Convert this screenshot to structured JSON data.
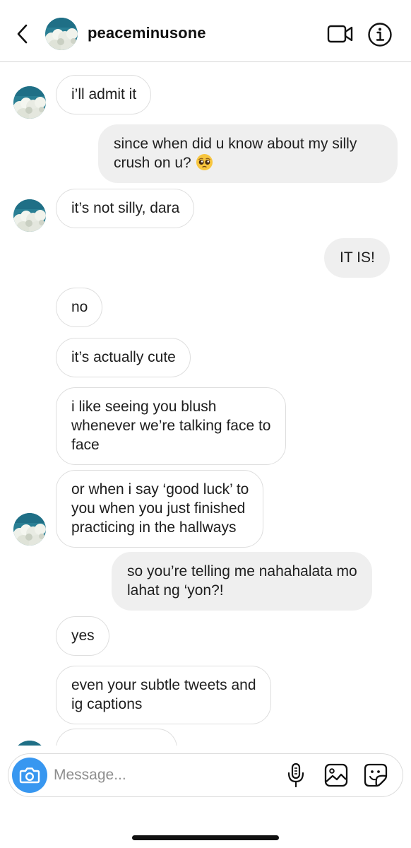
{
  "header": {
    "username": "peaceminusone",
    "back_icon": "chevron-left-icon",
    "video_icon": "video-call-icon",
    "info_icon": "info-icon"
  },
  "messages": [
    {
      "sender": "them",
      "text": "i’ll admit it"
    },
    {
      "sender": "me",
      "line1": "since when did u know about my silly",
      "line2": "crush on u? ",
      "emoji": "pleading-face-emoji"
    },
    {
      "sender": "them",
      "text": "it’s not silly, dara"
    },
    {
      "sender": "me",
      "text": "IT IS!"
    },
    {
      "sender": "them",
      "text": "no"
    },
    {
      "sender": "them",
      "text": "it’s actually cute"
    },
    {
      "sender": "them",
      "line1": "i like seeing you blush",
      "line2": "whenever we’re talking face to",
      "line3": "face"
    },
    {
      "sender": "them",
      "line1": "or when i say ‘good luck’ to",
      "line2": "you when you just finished",
      "line3": "practicing in the hallways"
    },
    {
      "sender": "me",
      "line1": "so you’re telling me nahahalata mo",
      "line2": "lahat ng ‘yon?!"
    },
    {
      "sender": "them",
      "text": "yes"
    },
    {
      "sender": "them",
      "line1": "even your subtle tweets and",
      "line2": "ig captions"
    }
  ],
  "composer": {
    "placeholder": "Message...",
    "camera_icon": "camera-icon",
    "mic_icon": "microphone-icon",
    "gallery_icon": "gallery-icon",
    "sticker_icon": "sticker-icon"
  },
  "colors": {
    "camera_button": "#3897f0",
    "incoming_border": "#dedede",
    "outgoing_bg": "#efefef",
    "avatar_sky": "#2a7f94"
  }
}
